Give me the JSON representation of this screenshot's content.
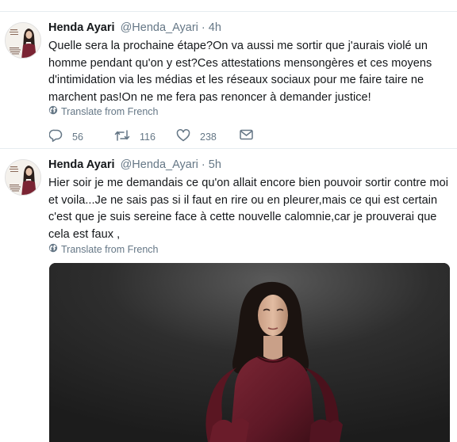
{
  "colors": {
    "text": "#14171a",
    "secondary": "#657786",
    "divider": "#e6ecf0",
    "photo_background": "#262626",
    "photo_blouse": "#6e1f2c"
  },
  "icons": {
    "reply": "speech-bubble",
    "retweet": "retweet-arrows",
    "like": "heart",
    "direct_message": "envelope",
    "translate": "globe"
  },
  "tweets": [
    {
      "name": "Henda Ayari",
      "handle": "@Henda_Ayari",
      "separator": "·",
      "time": "4h",
      "text": "Quelle sera la prochaine étape?On va aussi me sortir que j'aurais violé un homme pendant qu'on y est?Ces attestations mensongères et ces moyens d'intimidation via les médias et les réseaux sociaux pour me faire taire ne marchent pas!On ne me fera pas renoncer à demander justice!",
      "translate_label": "Translate from French",
      "replies": "56",
      "retweets": "116",
      "likes": "238"
    },
    {
      "name": "Henda Ayari",
      "handle": "@Henda_Ayari",
      "separator": "·",
      "time": "5h",
      "text": "Hier soir je me demandais ce qu'on allait encore bien pouvoir sortir  contre moi et voila...Je ne sais pas si il faut en rire ou en pleurer,mais ce qui est certain c'est que je suis sereine face à cette nouvelle calomnie,car je prouverai que cela est faux ,",
      "translate_label": "Translate from French"
    }
  ]
}
